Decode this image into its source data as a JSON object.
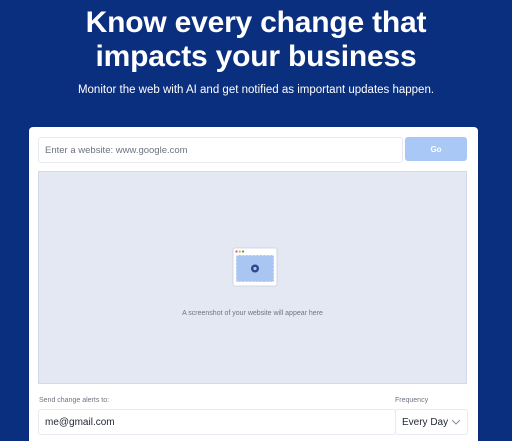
{
  "hero": {
    "headline_line1": "Know every change that",
    "headline_line2": "impacts your business",
    "subheadline": "Monitor the web with AI and get notified as important updates happen."
  },
  "url_form": {
    "placeholder": "Enter a website: www.google.com",
    "value": "",
    "go_label": "Go"
  },
  "preview": {
    "icon": "browser-screenshot-icon",
    "caption": "A screenshot of your website will appear here"
  },
  "alerts": {
    "label": "Send change alerts to:",
    "email_value": "me@gmail.com",
    "frequency_label": "Frequency",
    "frequency_value": "Every Day"
  },
  "colors": {
    "background": "#0b2f7f",
    "go_button": "#a9c8f6",
    "preview_bg": "#e3e8f2"
  }
}
